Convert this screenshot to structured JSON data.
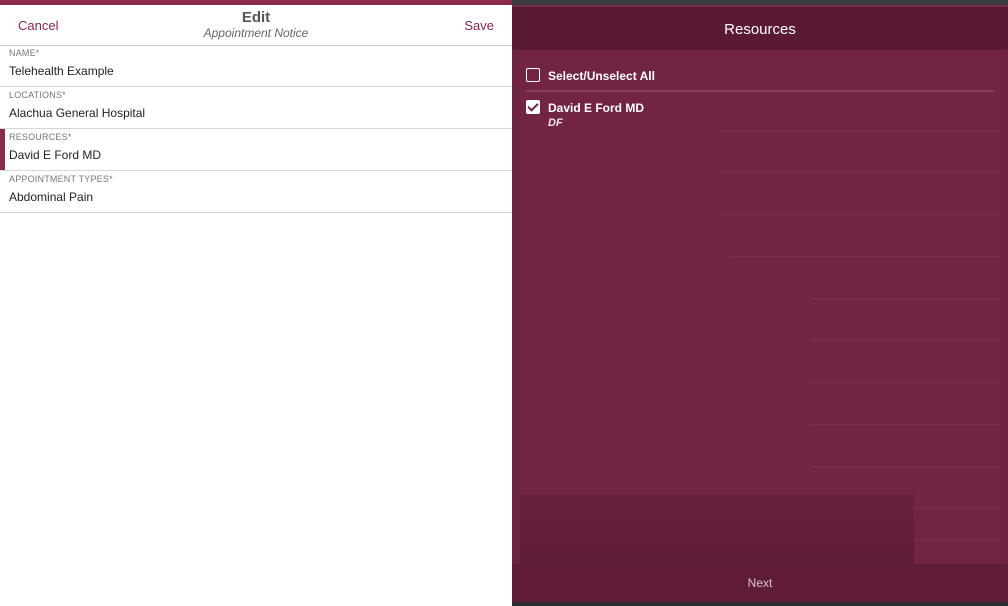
{
  "header": {
    "cancel_label": "Cancel",
    "title": "Edit",
    "subtitle": "Appointment Notice",
    "save_label": "Save"
  },
  "fields": [
    {
      "label": "NAME*",
      "value": "Telehealth Example"
    },
    {
      "label": "LOCATIONS*",
      "value": "Alachua General Hospital"
    },
    {
      "label": "RESOURCES*",
      "value": "David E Ford MD"
    },
    {
      "label": "APPOINTMENT TYPES*",
      "value": "Abdominal Pain"
    }
  ],
  "resources_panel": {
    "title": "Resources",
    "select_all_label": "Select/Unselect All",
    "select_all_checked": false,
    "items": [
      {
        "name": "David E Ford MD",
        "initials": "DF",
        "checked": true
      }
    ],
    "next_label": "Next"
  },
  "colors": {
    "accent": "#8a2b4c",
    "panel_bg": "#6d2242",
    "panel_header": "#5a1a35"
  }
}
